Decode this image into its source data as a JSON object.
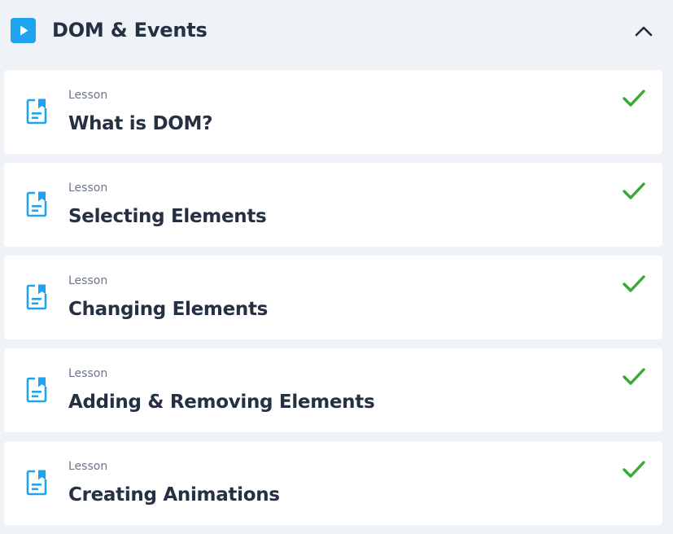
{
  "section": {
    "title": "DOM & Events",
    "play_icon": "play-icon",
    "toggle_icon": "chevron-up-icon",
    "expanded": true
  },
  "colors": {
    "accent": "#1ea4ef",
    "complete": "#3aa935",
    "card_background": "#ffffff",
    "page_background": "#eff2f6"
  },
  "lessons": [
    {
      "type": "Lesson",
      "title": "What is DOM?",
      "icon": "lesson-document-icon",
      "status": "completed",
      "status_icon": "checkmark-icon"
    },
    {
      "type": "Lesson",
      "title": "Selecting Elements",
      "icon": "lesson-document-icon",
      "status": "completed",
      "status_icon": "checkmark-icon"
    },
    {
      "type": "Lesson",
      "title": "Changing Elements",
      "icon": "lesson-document-icon",
      "status": "completed",
      "status_icon": "checkmark-icon"
    },
    {
      "type": "Lesson",
      "title": "Adding & Removing Elements",
      "icon": "lesson-document-icon",
      "status": "completed",
      "status_icon": "checkmark-icon"
    },
    {
      "type": "Lesson",
      "title": "Creating Animations",
      "icon": "lesson-document-icon",
      "status": "completed",
      "status_icon": "checkmark-icon"
    }
  ]
}
